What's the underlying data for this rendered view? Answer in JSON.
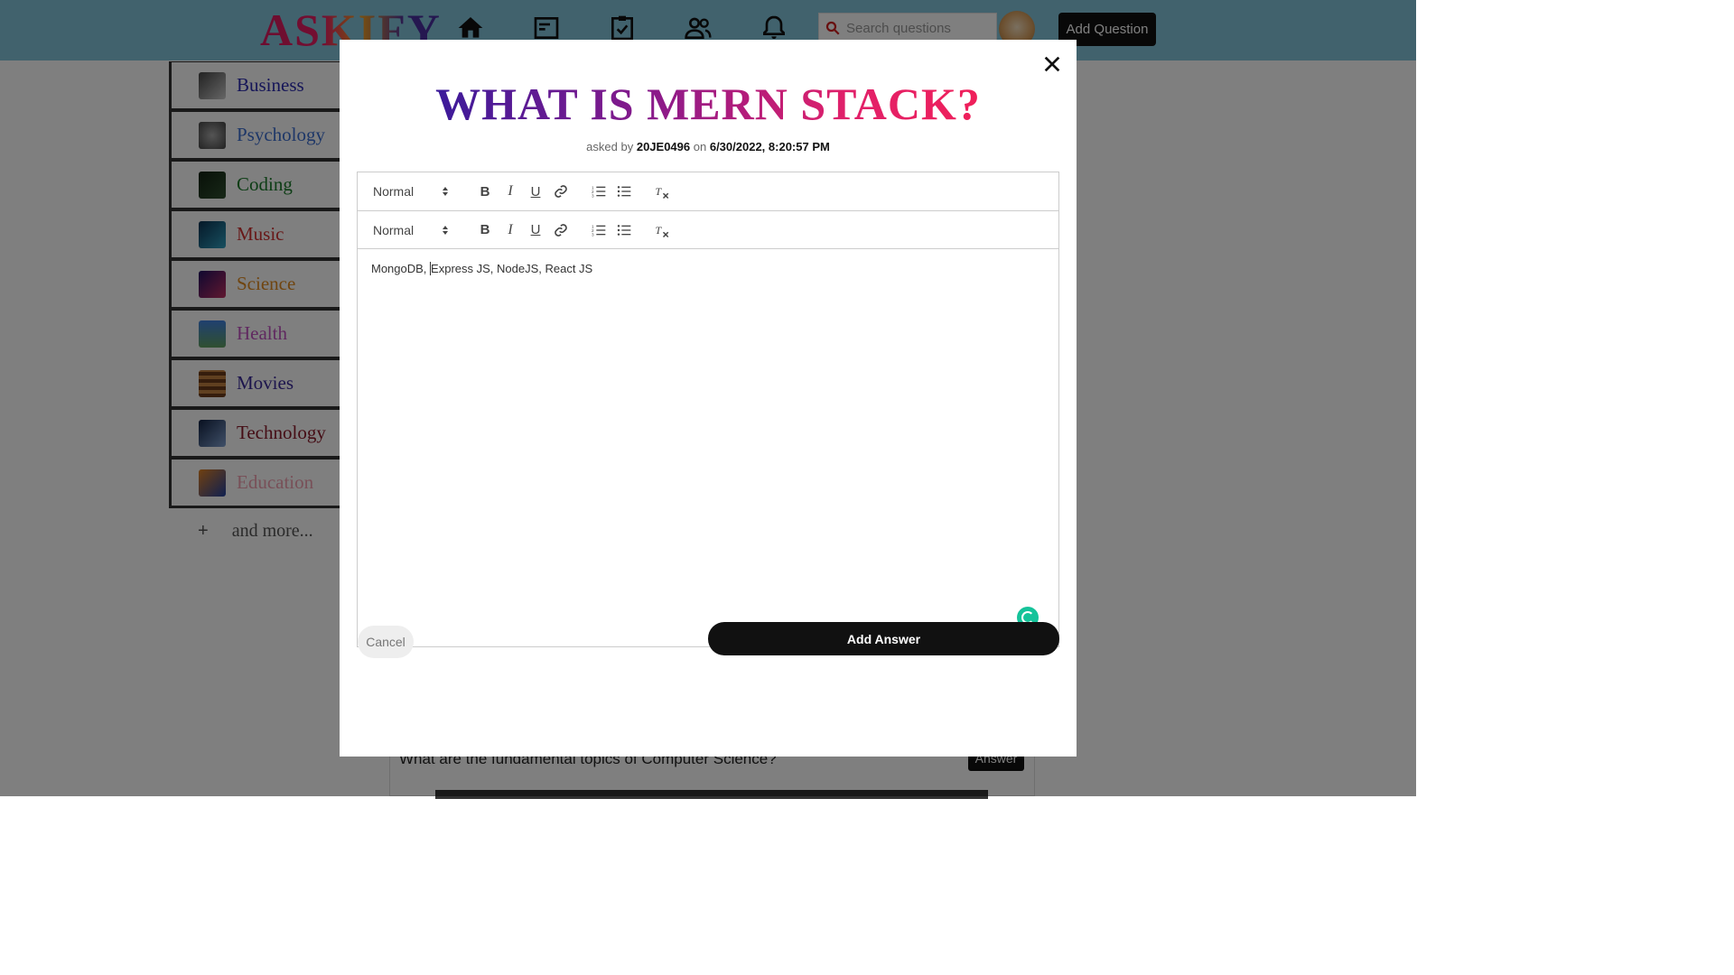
{
  "header": {
    "logo": "ASKIFY",
    "nav_icons": [
      "home-icon",
      "article-icon",
      "assignment-check-icon",
      "people-icon",
      "bell-icon"
    ],
    "search_placeholder": "Search questions",
    "add_question_label": "Add Question"
  },
  "sidebar": {
    "items": [
      {
        "label": "Business",
        "color": "#2a2ab0"
      },
      {
        "label": "Psychology",
        "color": "#3d6fd0"
      },
      {
        "label": "Coding",
        "color": "#1a7a2a"
      },
      {
        "label": "Music",
        "color": "#d03030"
      },
      {
        "label": "Science",
        "color": "#e08a20"
      },
      {
        "label": "Health",
        "color": "#c050c0"
      },
      {
        "label": "Movies",
        "color": "#3a2a9a"
      },
      {
        "label": "Technology",
        "color": "#8a1a2a"
      },
      {
        "label": "Education",
        "color": "#f0a0b0"
      }
    ],
    "more_label": "and more...",
    "more_icon": "+"
  },
  "feed": {
    "question": "What are the fundamental topics of Computer Science?",
    "answer_label": "Answer"
  },
  "modal": {
    "title": "WHAT IS MERN STACK?",
    "asked_by_prefix": "asked by",
    "author": "20JE0496",
    "on_text": "on",
    "date": "6/30/2022, 8:20:57 PM",
    "toolbar": {
      "format_value": "Normal",
      "buttons": [
        "bold-icon",
        "italic-icon",
        "underline-icon",
        "link-icon",
        "ordered-list-icon",
        "bullet-list-icon",
        "clear-format-icon"
      ]
    },
    "editor_text_before_cursor": "MongoDB, ",
    "editor_text_after_cursor": "Express JS, NodeJS, React JS",
    "cancel_label": "Cancel",
    "add_answer_label": "Add Answer"
  }
}
